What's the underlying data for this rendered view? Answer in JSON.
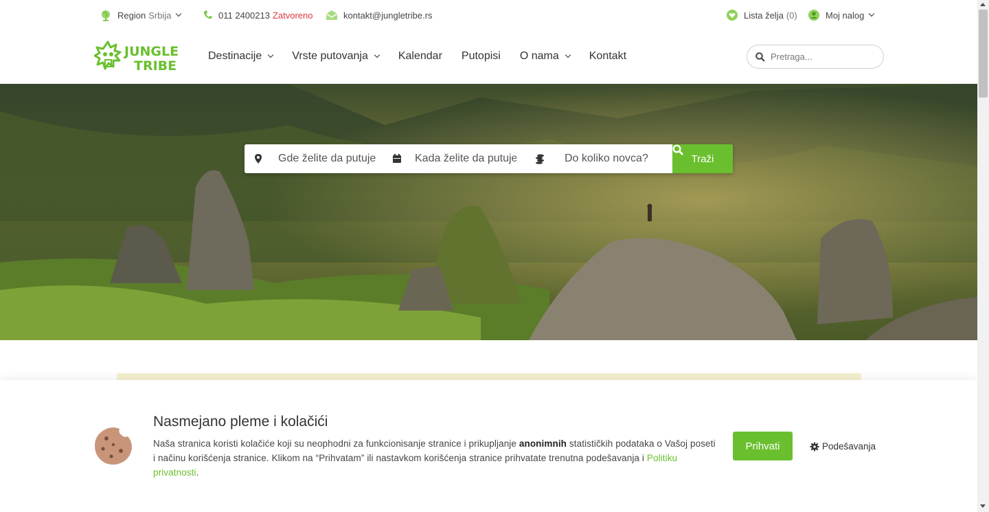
{
  "topbar": {
    "region_label": "Region",
    "region_value": "Srbija",
    "phone": "011 2400213",
    "phone_status": "Zatvoreno",
    "email": "kontakt@jungletribe.rs",
    "wishlist_label": "Lista želja",
    "wishlist_count": "(0)",
    "account_label": "Moj nalog"
  },
  "logo": {
    "text_line1": "JUNGLE",
    "text_line2": "TRIBE"
  },
  "nav": {
    "items": [
      {
        "label": "Destinacije"
      },
      {
        "label": "Vrste putovanja"
      },
      {
        "label": "Kalendar"
      },
      {
        "label": "Putopisi"
      },
      {
        "label": "O nama"
      },
      {
        "label": "Kontakt"
      }
    ],
    "search_placeholder": "Pretraga..."
  },
  "hero_search": {
    "where_placeholder": "Gde želite da putujete?",
    "when_placeholder": "Kada želite da putujete?",
    "budget_placeholder": "Do koliko novca?",
    "button_label": "Traži"
  },
  "cookie": {
    "title": "Nasmejano pleme i kolačići",
    "text_before": "Naša stranica koristi kolačiće koji su neophodni za funkcionisanje stranice i prikupljanje ",
    "text_bold": "anonimnih",
    "text_after": " statističkih podataka o Vašoj poseti i načinu korišćenja stranice. Klikom na “Prihvatam” ili nastavkom korišćenja stranice prihvatate trenutna podešavanja i ",
    "link": "Politiku privatnosti",
    "text_end": ".",
    "accept_label": "Prihvati",
    "settings_label": "Podešavanja"
  },
  "colors": {
    "accent": "#6abf2e",
    "status_red": "#d9383a",
    "notice_bg": "#f4f0cf",
    "cookie_brown": "#c9957a"
  },
  "icons": {
    "region": "globe-icon",
    "phone": "phone-icon",
    "email": "envelope-icon",
    "wishlist": "heart-icon",
    "account": "user-icon",
    "search": "search-icon",
    "location": "map-pin-icon",
    "calendar": "calendar-icon",
    "money": "coins-icon",
    "cookie": "cookie-icon",
    "settings": "gear-icon"
  }
}
